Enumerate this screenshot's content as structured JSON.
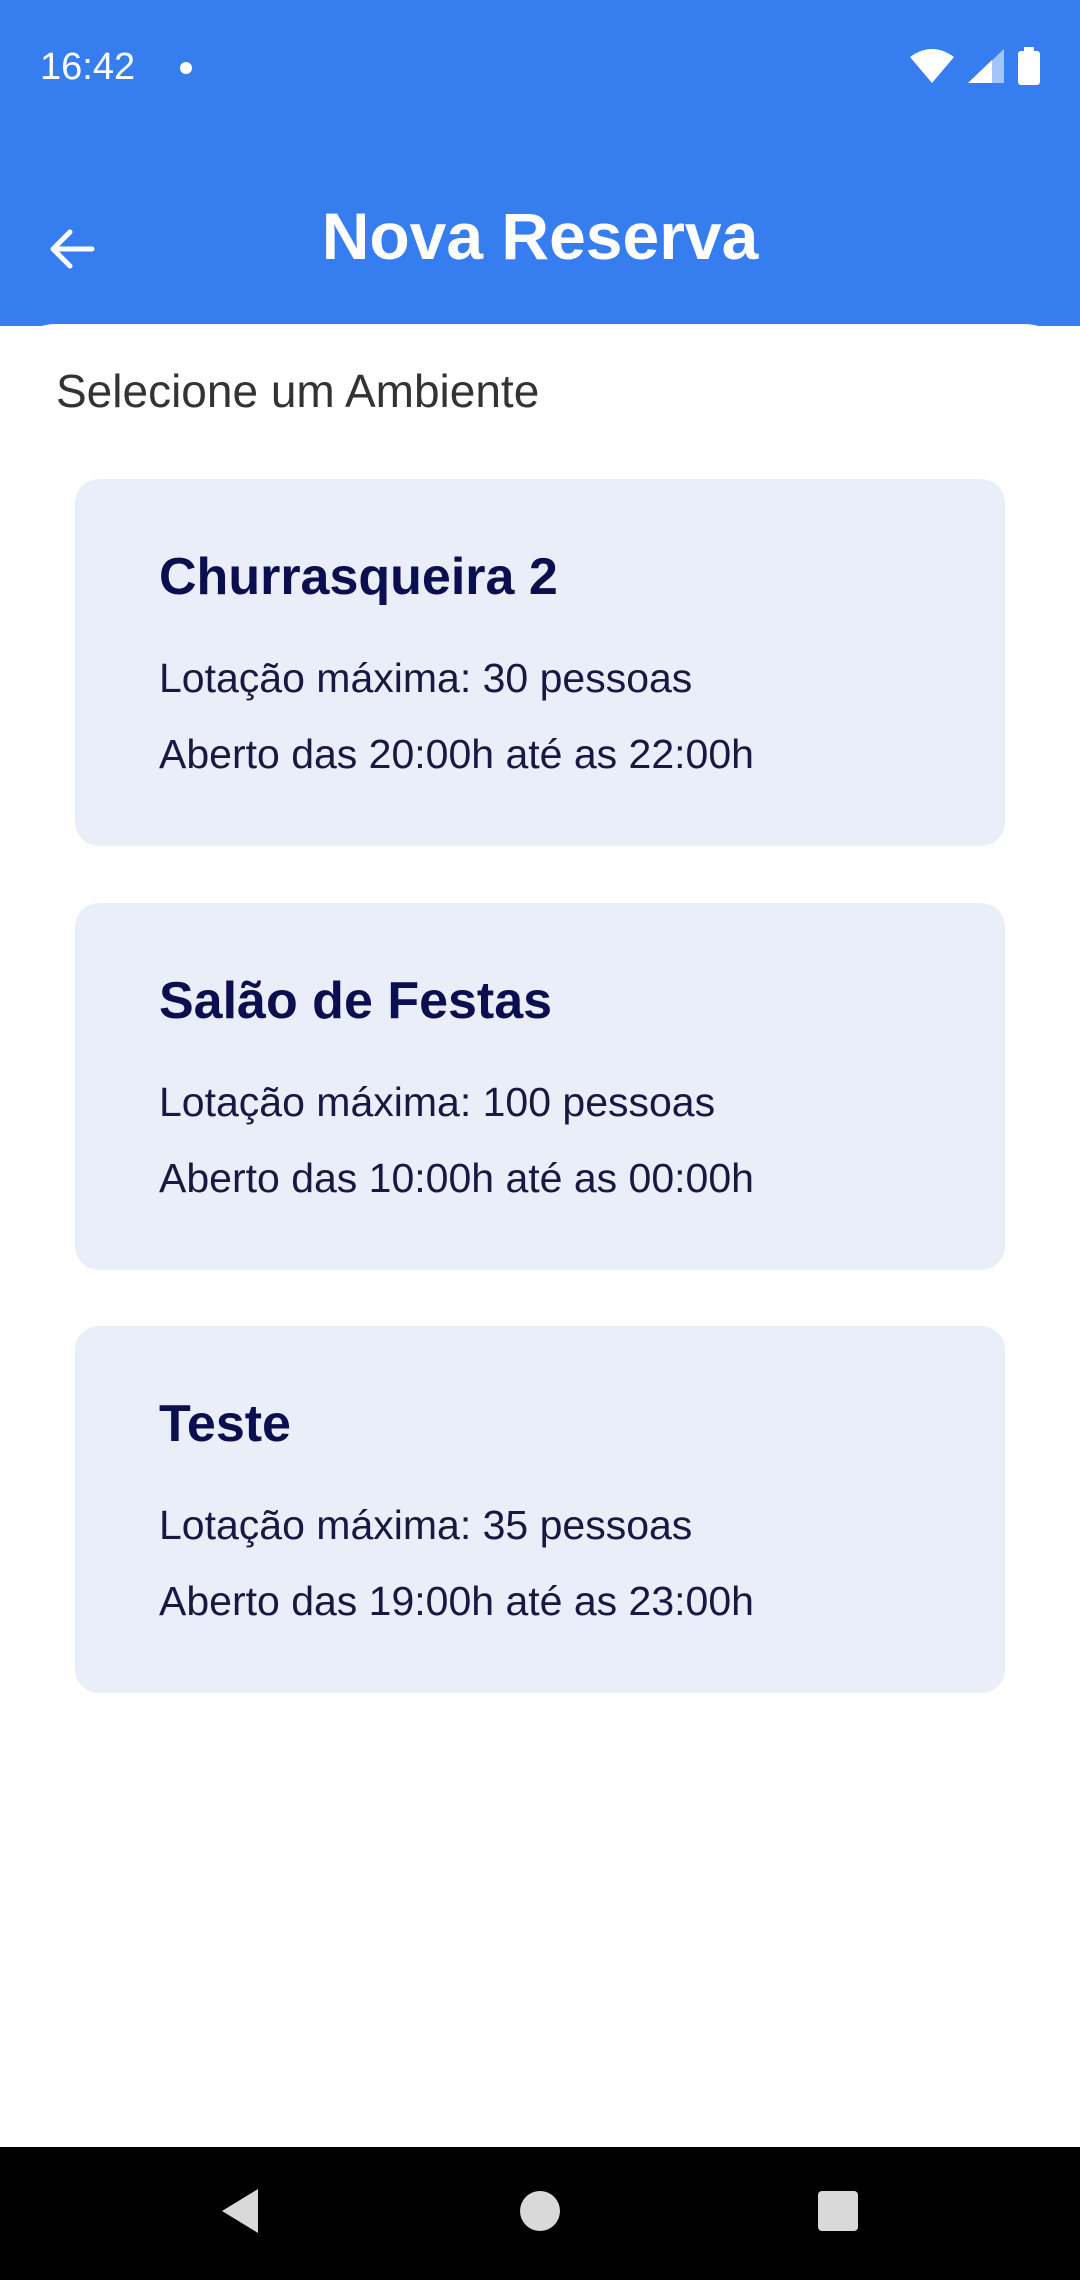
{
  "status_bar": {
    "time": "16:42",
    "icons": [
      "notification-dot-icon",
      "wifi-icon",
      "cellular-signal-icon",
      "battery-icon"
    ]
  },
  "header": {
    "title": "Nova Reserva",
    "back_icon": "arrow-left-icon"
  },
  "main": {
    "subtitle": "Selecione um Ambiente",
    "ambientes": [
      {
        "name": "Churrasqueira 2",
        "capacity": "Lotação máxima: 30 pessoas",
        "hours": "Aberto das 20:00h até as 22:00h"
      },
      {
        "name": "Salão de Festas",
        "capacity": "Lotação máxima: 100 pessoas",
        "hours": "Aberto das 10:00h até as 00:00h"
      },
      {
        "name": "Teste",
        "capacity": "Lotação máxima: 35 pessoas",
        "hours": "Aberto das 19:00h até as 23:00h"
      }
    ]
  },
  "nav_bar": {
    "icons": [
      "back-triangle-icon",
      "home-circle-icon",
      "recents-square-icon"
    ]
  },
  "colors": {
    "primary": "#367ef0",
    "card_bg": "#eaeef8",
    "card_title": "#0b0e4f",
    "card_text": "#161942"
  }
}
